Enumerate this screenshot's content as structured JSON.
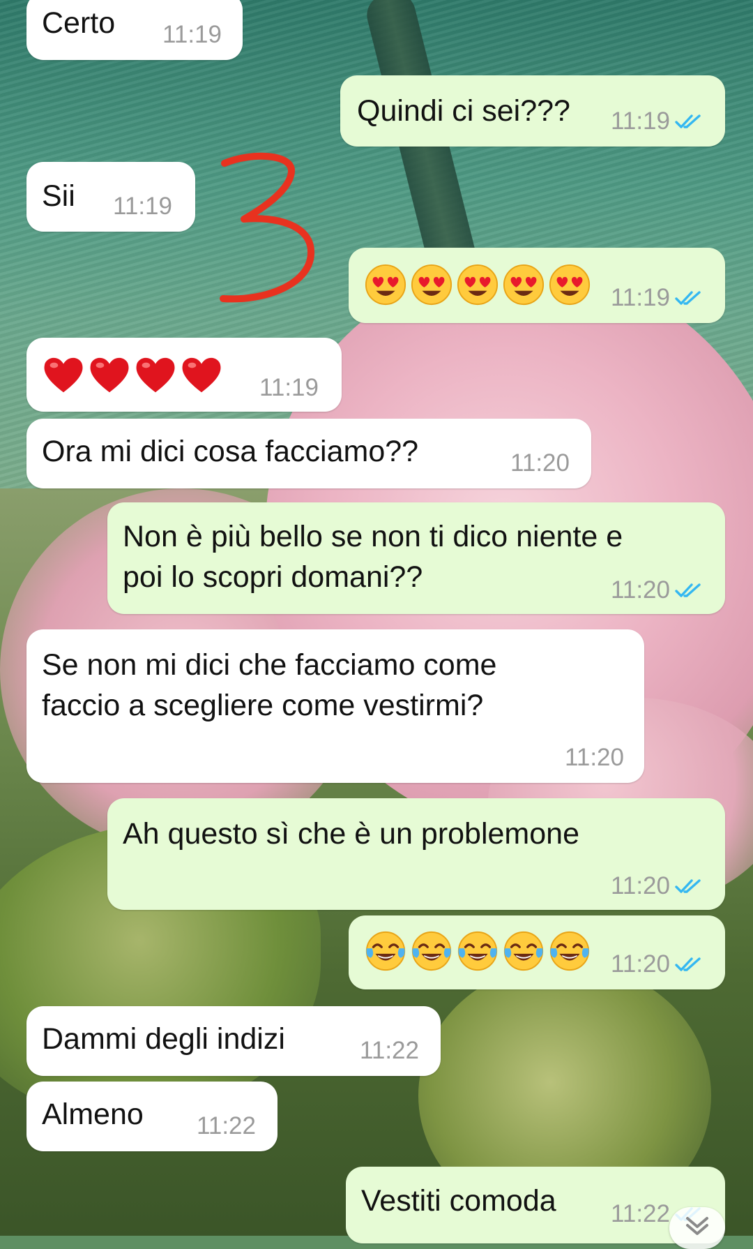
{
  "chat": {
    "messages": [
      {
        "direction": "in",
        "text": "Certo",
        "time": "11:19"
      },
      {
        "direction": "out",
        "text": "Quindi ci sei???",
        "time": "11:19",
        "status": "read"
      },
      {
        "direction": "in",
        "text": "Sii",
        "time": "11:19"
      },
      {
        "direction": "out",
        "text": "😍😍😍😍😍",
        "time": "11:19",
        "status": "read"
      },
      {
        "direction": "in",
        "text": "❤️❤️❤️❤️",
        "time": "11:19"
      },
      {
        "direction": "in",
        "text": "Ora mi dici cosa facciamo??",
        "time": "11:20"
      },
      {
        "direction": "out",
        "text": "Non è più bello se non ti dico niente e poi lo scopri domani??",
        "line1": "Non è più bello se non ti dico niente e",
        "line2": "poi lo scopri domani??",
        "time": "11:20",
        "status": "read"
      },
      {
        "direction": "in",
        "text": "Se non mi dici che facciamo come faccio a scegliere come vestirmi?",
        "line1": "Se non mi dici che facciamo come",
        "line2": "faccio a scegliere come vestirmi?",
        "time": "11:20"
      },
      {
        "direction": "out",
        "text": "Ah questo sì che è un problemone",
        "time": "11:20",
        "status": "read"
      },
      {
        "direction": "out",
        "text": "😂😂😂😂😂",
        "time": "11:20",
        "status": "read"
      },
      {
        "direction": "in",
        "text": "Dammi degli indizi",
        "time": "11:22"
      },
      {
        "direction": "in",
        "text": "Almeno",
        "time": "11:22"
      },
      {
        "direction": "out",
        "text": "Vestiti comoda",
        "time": "11:22",
        "status": "read"
      }
    ]
  },
  "annotation": {
    "text": "3",
    "color": "#e8321f"
  },
  "colors": {
    "incoming_bubble": "#ffffff",
    "outgoing_bubble": "#e6fbd5",
    "read_ticks": "#34b7f1",
    "timestamp": "#9a9a9a"
  },
  "icons": {
    "read_status": "double-check-icon",
    "scroll_down": "chevron-down-icon"
  }
}
